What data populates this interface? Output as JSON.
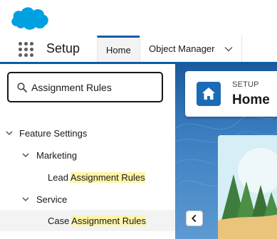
{
  "nav": {
    "app_name": "Setup",
    "tabs": [
      {
        "label": "Home"
      },
      {
        "label": "Object Manager"
      }
    ]
  },
  "sidebar": {
    "search_value": "Assignment Rules",
    "tree": [
      {
        "prefix": "Feature Settings",
        "match": ""
      },
      {
        "prefix": "Marketing",
        "match": ""
      },
      {
        "prefix": "Lead ",
        "match": "Assignment Rules"
      },
      {
        "prefix": "Service",
        "match": ""
      },
      {
        "prefix": "Case ",
        "match": "Assignment Rules"
      }
    ]
  },
  "main": {
    "header_eyebrow": "SETUP",
    "header_title": "Home"
  },
  "colors": {
    "brand_blue": "#0b5cab",
    "salesforce_cloud": "#00a1e0",
    "highlight": "#fff5a8"
  },
  "icons": [
    "salesforce-logo-icon",
    "app-launcher-icon",
    "chevron-down-icon",
    "search-icon",
    "caret-down-icon",
    "home-icon",
    "chevron-left-icon"
  ]
}
